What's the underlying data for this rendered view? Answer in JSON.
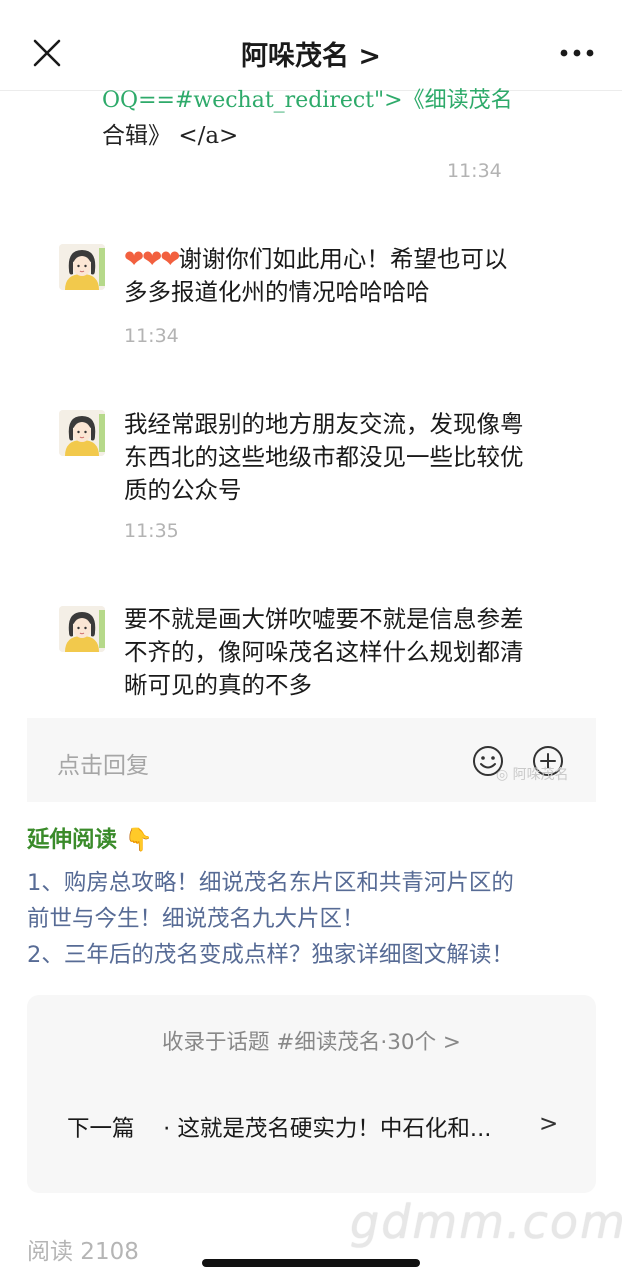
{
  "nav": {
    "title": "阿哚茂名 >"
  },
  "chat": {
    "code_line": "OQ==#wechat_redirect\">《细读茂名",
    "code_line2_text": "合辑》",
    "code_line2_tag": "</a>",
    "time1": "11:34",
    "msg1_hearts": "❤❤❤",
    "msg1_text": "谢谢你们如此用心！希望也可以多多报道化州的情况哈哈哈哈",
    "time2": "11:34",
    "msg2_text": "我经常跟别的地方朋友交流，发现像粤东西北的这些地级市都没见一些比较优质的公众号",
    "time3": "11:35",
    "msg3_text": "要不就是画大饼吹嘘要不就是信息参差不齐的，像阿哚茂名这样什么规划都清晰可见的真的不多"
  },
  "reply": {
    "placeholder": "点击回复"
  },
  "extended": {
    "heading": "延伸阅读 👇",
    "item1_line1": "1、购房总攻略！细说茂名东片区和共青河片区的",
    "item1_line2": "前世与今生！细说茂名九大片区！",
    "item2": "2、三年后的茂名变成点样？独家详细图文解读！"
  },
  "topic_card": {
    "topic": "收录于话题 #细读茂名·30个 >",
    "next_label": "下一篇",
    "next_title": "· 这就是茂名硬实力！中石化和...",
    "chevron": ">"
  },
  "footer": {
    "reads": "阅读 2108"
  },
  "watermarks": {
    "wechat": "阿哚茂名",
    "site": "gdmm.com"
  },
  "colors": {
    "link": "#576b95",
    "green": "#3a8b2a",
    "code_green": "#2eaa6a"
  }
}
